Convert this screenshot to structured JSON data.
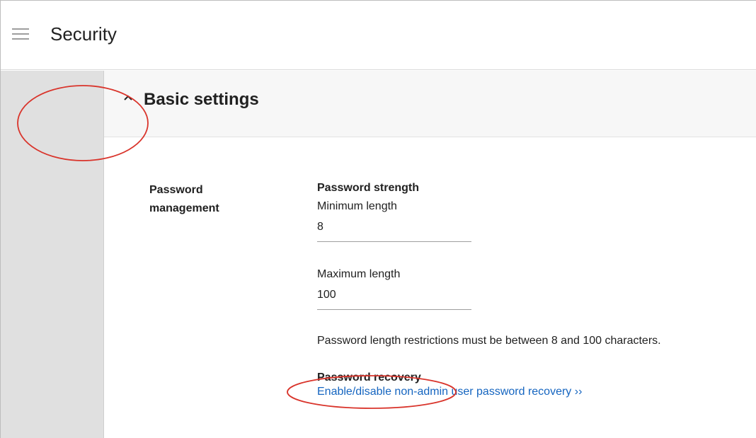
{
  "header": {
    "menu_icon": "hamburger-menu-icon",
    "title": "Security"
  },
  "section": {
    "toggle_icon": "chevron-up-icon",
    "title": "Basic settings"
  },
  "password_management": {
    "label_line1": "Password",
    "label_line2": "management"
  },
  "password_strength": {
    "heading": "Password strength",
    "min_label": "Minimum length",
    "min_value": "8",
    "max_label": "Maximum length",
    "max_value": "100",
    "hint": "Password length restrictions must be between 8 and 100 characters."
  },
  "password_recovery": {
    "heading": "Password recovery",
    "link": "Enable/disable non-admin user password recovery ››"
  },
  "colors": {
    "annotation": "#d9342b",
    "link": "#1565c0",
    "gutter": "#e0e0e0"
  }
}
